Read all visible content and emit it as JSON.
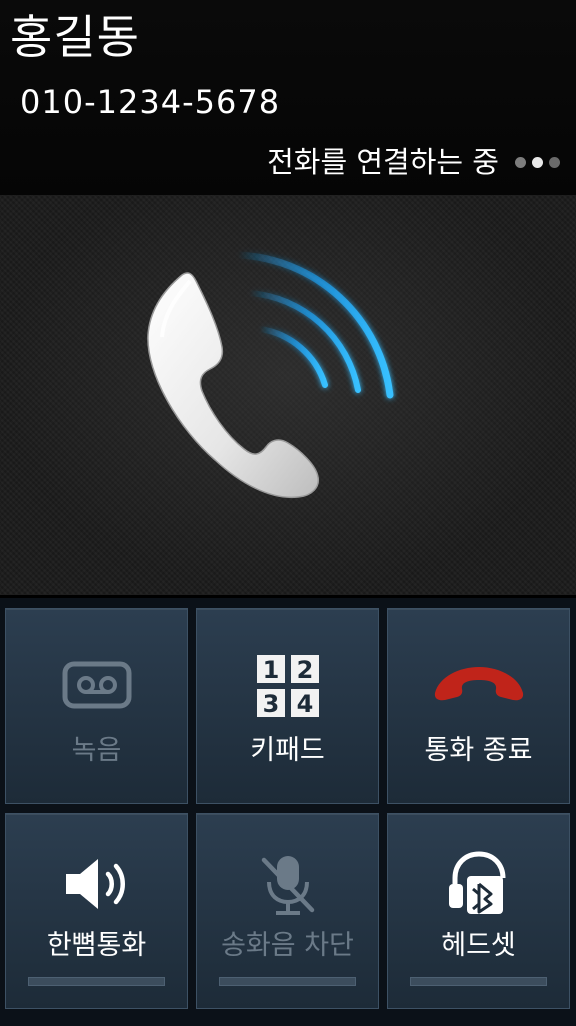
{
  "caller": {
    "name": "홍길동",
    "number": "010-1234-5678",
    "status": "전화를 연결하는 중"
  },
  "colors": {
    "accent_wave": "#1ea9ff",
    "end_call_red": "#c0241a",
    "button_bg": "#25374a",
    "disabled_text": "#6b7a88"
  },
  "buttons": [
    {
      "id": "record",
      "label": "녹음",
      "icon": "cassette-icon",
      "enabled": false
    },
    {
      "id": "keypad",
      "label": "키패드",
      "icon": "keypad-icon",
      "enabled": true,
      "keypad_digits": [
        "1",
        "2",
        "3",
        "4"
      ]
    },
    {
      "id": "end_call",
      "label": "통화 종료",
      "icon": "end-call-icon",
      "enabled": true
    },
    {
      "id": "speaker",
      "label": "한뼘통화",
      "icon": "speaker-icon",
      "enabled": true
    },
    {
      "id": "mute",
      "label": "송화음 차단",
      "icon": "muted-mic-icon",
      "enabled": false
    },
    {
      "id": "headset",
      "label": "헤드셋",
      "icon": "bluetooth-headset-icon",
      "enabled": true
    }
  ]
}
